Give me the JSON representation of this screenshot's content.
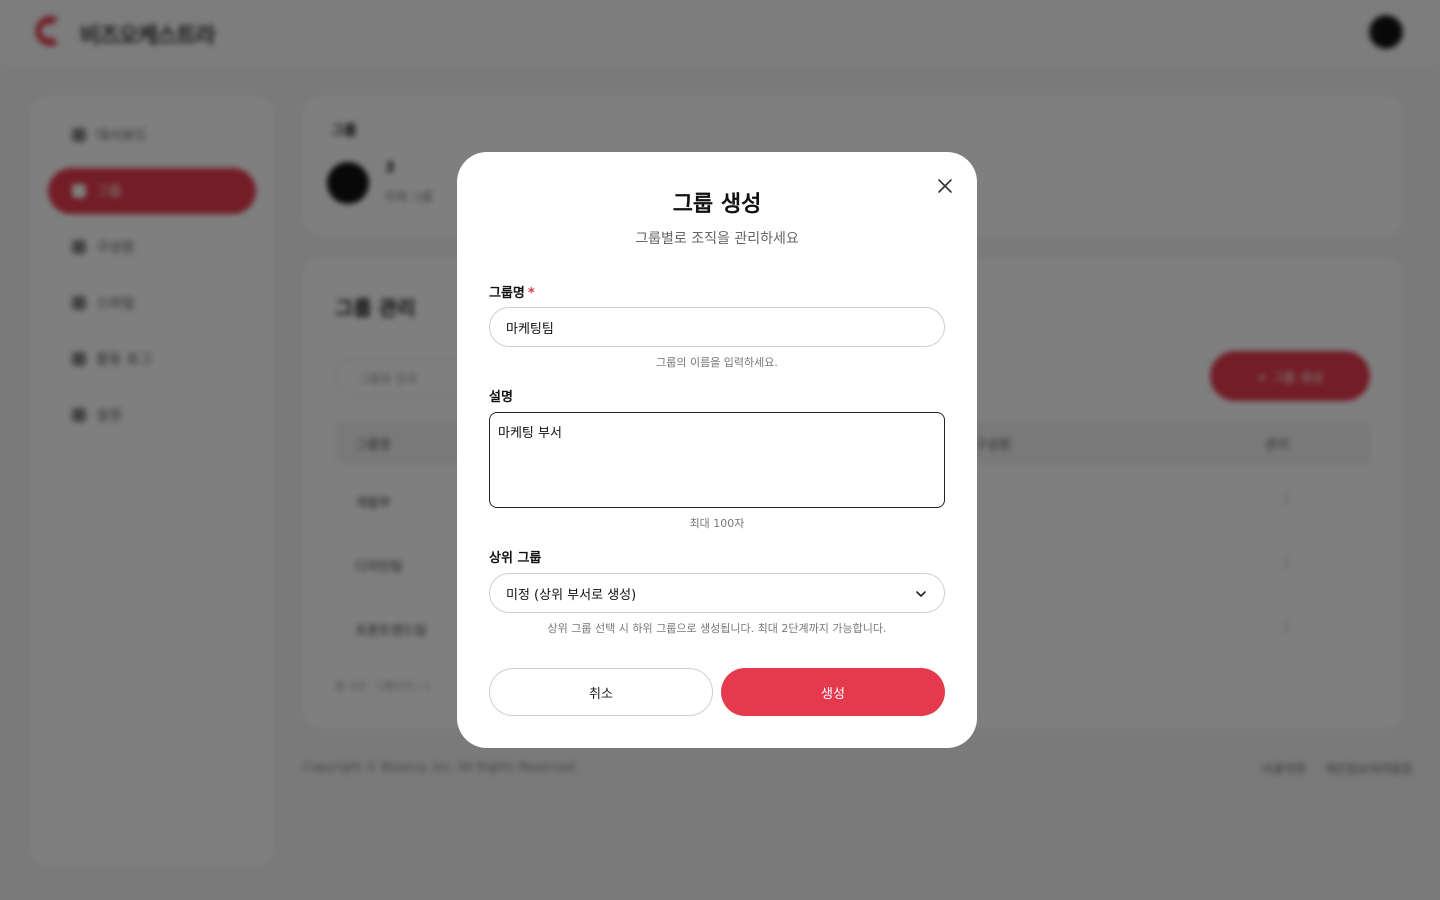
{
  "app": {
    "brand": "비즈오케스트라",
    "sidebar": {
      "items": [
        {
          "label": "대시보드",
          "icon": "dashboard-icon"
        },
        {
          "label": "그룹",
          "icon": "group-icon",
          "active": true
        },
        {
          "label": "구성원",
          "icon": "members-icon"
        },
        {
          "label": "스마일",
          "icon": "smile-icon"
        },
        {
          "label": "활동 로그",
          "icon": "log-icon"
        },
        {
          "label": "설정",
          "icon": "settings-icon"
        }
      ]
    },
    "top_card": {
      "title": "그룹",
      "name": "3",
      "subtitle": "전체 그룹"
    },
    "group_card": {
      "title": "그룹 관리",
      "search_placeholder": "그룹명 검색",
      "add_button": "+ 그룹 생성",
      "columns": [
        "그룹명",
        "구성원",
        "관리"
      ],
      "rows": [
        {
          "name": "개발부",
          "action": "⋮"
        },
        {
          "name": "디자인팀",
          "action": "⋮"
        },
        {
          "name": "프론트엔드팀",
          "action": "⋮"
        }
      ],
      "footer": "총 3건 · 1페이지 / 1"
    },
    "copyright": "Copyright © Bizorca, Inc. All Rights Reserved.",
    "footer_links": [
      "이용약관",
      "개인정보처리방침"
    ]
  },
  "modal": {
    "title": "그룹 생성",
    "subtitle": "그룹별로 조직을 관리하세요",
    "name_label": "그룹명",
    "required_mark": "*",
    "name_value": "마케팅팀",
    "name_help": "그룹의 이름을 입력하세요.",
    "desc_label": "설명",
    "desc_value": "마케팅 부서",
    "desc_help": "최대 100자",
    "parent_label": "상위 그룹",
    "parent_value": "미정 (상위 부서로 생성)",
    "parent_help": "상위 그룹 선택 시 하위 그룹으로 생성됩니다. 최대 2단계까지 가능합니다.",
    "cancel_label": "취소",
    "create_label": "생성"
  },
  "colors": {
    "accent": "#e53a4e",
    "overlay": "rgba(0,0,0,0.5)"
  }
}
